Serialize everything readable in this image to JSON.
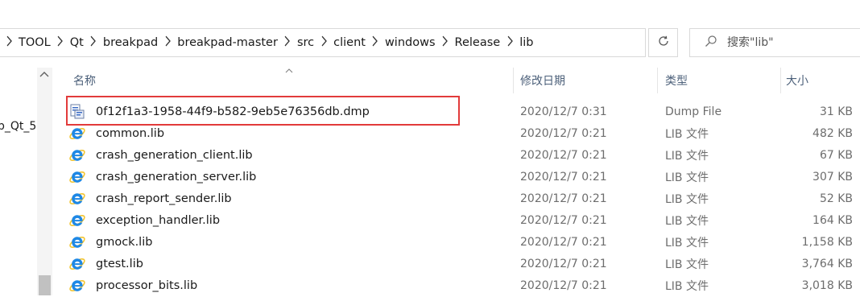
{
  "breadcrumb": [
    "TOOL",
    "Qt",
    "breakpad",
    "breakpad-master",
    "src",
    "client",
    "windows",
    "Release",
    "lib"
  ],
  "search": {
    "placeholder": "搜索\"lib\""
  },
  "nav_pane": {
    "partial_item": "p_Qt_5"
  },
  "columns": {
    "name": "名称",
    "date": "修改日期",
    "type": "类型",
    "size": "大小"
  },
  "files": [
    {
      "name": "0f12f1a3-1958-44f9-b582-9eb5e76356db.dmp",
      "date": "2020/12/7 0:31",
      "type": "Dump File",
      "size": "31 KB",
      "icon": "dump-file-icon"
    },
    {
      "name": "common.lib",
      "date": "2020/12/7 0:21",
      "type": "LIB 文件",
      "size": "482 KB",
      "icon": "ie-icon"
    },
    {
      "name": "crash_generation_client.lib",
      "date": "2020/12/7 0:21",
      "type": "LIB 文件",
      "size": "67 KB",
      "icon": "ie-icon"
    },
    {
      "name": "crash_generation_server.lib",
      "date": "2020/12/7 0:21",
      "type": "LIB 文件",
      "size": "307 KB",
      "icon": "ie-icon"
    },
    {
      "name": "crash_report_sender.lib",
      "date": "2020/12/7 0:21",
      "type": "LIB 文件",
      "size": "52 KB",
      "icon": "ie-icon"
    },
    {
      "name": "exception_handler.lib",
      "date": "2020/12/7 0:21",
      "type": "LIB 文件",
      "size": "164 KB",
      "icon": "ie-icon"
    },
    {
      "name": "gmock.lib",
      "date": "2020/12/7 0:21",
      "type": "LIB 文件",
      "size": "1,158 KB",
      "icon": "ie-icon"
    },
    {
      "name": "gtest.lib",
      "date": "2020/12/7 0:21",
      "type": "LIB 文件",
      "size": "3,764 KB",
      "icon": "ie-icon"
    },
    {
      "name": "processor_bits.lib",
      "date": "2020/12/7 0:21",
      "type": "LIB 文件",
      "size": "3,018 KB",
      "icon": "ie-icon"
    }
  ],
  "colors": {
    "highlight": "#e23b3b",
    "header_text": "#4c607a",
    "ie_blue": "#1e88e5",
    "ie_ring": "#f2c531"
  }
}
